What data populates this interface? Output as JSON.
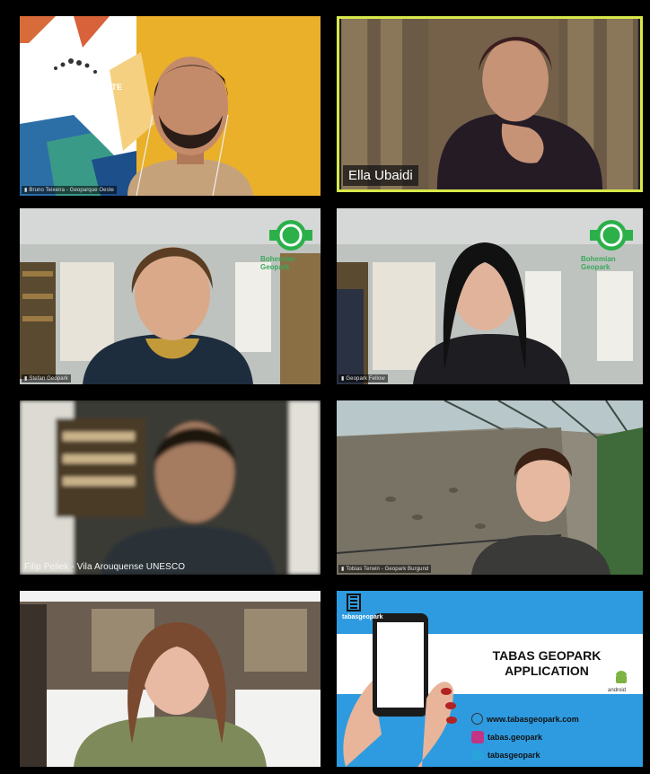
{
  "participants": [
    {
      "caption": "Bruno Teixeira - Geoparque Oeste",
      "logo_small": "Geoparque",
      "logo_text": "GEOPARQUE OESTE"
    },
    {
      "caption": "Ella Ubaidi"
    },
    {
      "caption": "Stefan Geopark",
      "badge": "Bohemian Geopark"
    },
    {
      "caption": "Geopark Fellow",
      "badge": "Bohemian Geopark"
    },
    {
      "caption": "Filip Peliek - Vila Arouquense UNESCO"
    },
    {
      "caption": "Tobias Terwin - Geopark Burgund"
    },
    {
      "caption": ""
    },
    {
      "caption": "",
      "logo_text": "tabasgeopark",
      "title_line1": "TABAS GEOPARK",
      "title_line2": "APPLICATION",
      "android": "android",
      "links": [
        {
          "icon": "globe-icon",
          "text": "www.tabasgeopark.com"
        },
        {
          "icon": "instagram-icon",
          "text": "tabas.geopark"
        },
        {
          "icon": "telegram-icon",
          "text": "tabasgeopark"
        }
      ]
    }
  ],
  "colors": {
    "active_speaker": "#d7e94a",
    "tabas_blue": "#2e9be0",
    "geoparque_yellow": "#eab02a"
  }
}
